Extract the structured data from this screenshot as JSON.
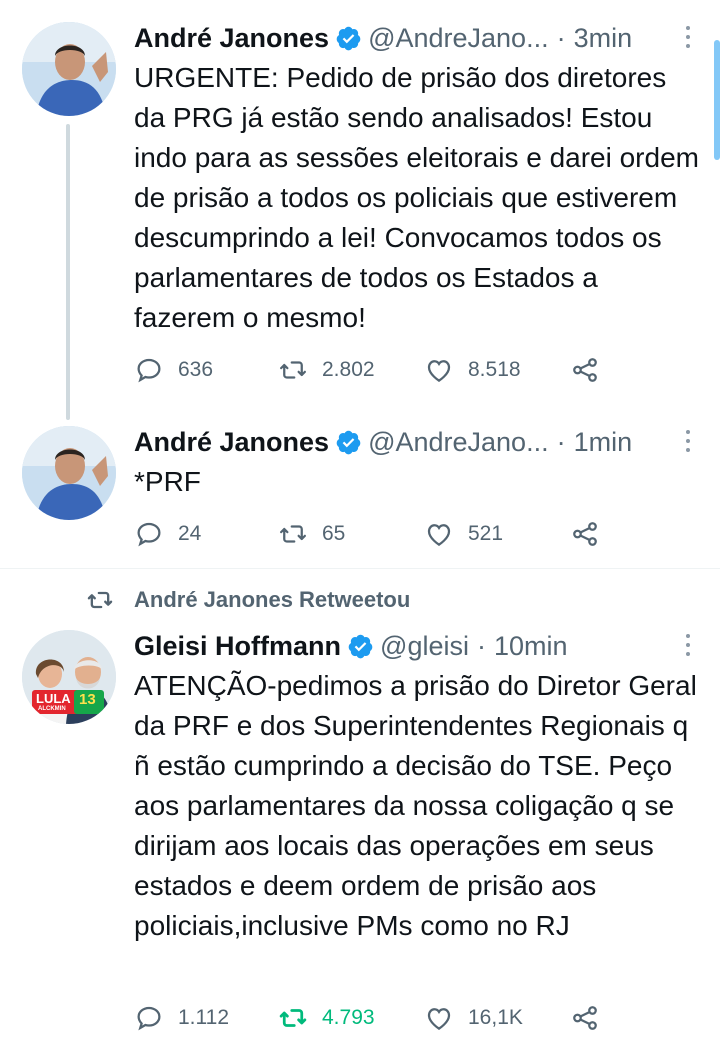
{
  "tweets": [
    {
      "name": "André Janones",
      "handle": "@AndreJano...",
      "dot": "·",
      "time": "3min",
      "text": "URGENTE: Pedido de prisão dos diretores da PRG já estão sendo analisados! Estou indo para as sessões eleitorais e darei ordem de prisão a todos os policiais que estiverem descumprindo a lei! Convocamos todos os parlamentares de todos os Estados a fazerem o mesmo!",
      "replies": "636",
      "retweets": "2.802",
      "likes": "8.518"
    },
    {
      "name": "André Janones",
      "handle": "@AndreJano...",
      "dot": "·",
      "time": "1min",
      "text": "*PRF",
      "replies": "24",
      "retweets": "65",
      "likes": "521"
    },
    {
      "retweeted_by": "André Janones Retweetou",
      "name": "Gleisi Hoffmann",
      "handle": "@gleisi",
      "dot": "·",
      "time": "10min",
      "text": "ATENÇÃO-pedimos a prisão do Diretor Geral da PRF e dos Superintendentes Regionais q ñ estão cumprindo a decisão do TSE. Peço aos parlamentares da nossa coligação q se dirijam aos locais das operações em seus estados e deem ordem de prisão aos policiais,inclusive PMs como no RJ",
      "replies": "1.112",
      "retweets": "4.793",
      "likes": "16,1K"
    }
  ],
  "avatar_badge": {
    "lula": "LULA",
    "number": "13",
    "sub": "ALCKMIN"
  },
  "colors": {
    "verified": "#1d9bf0",
    "retweet_active": "#00ba7c",
    "secondary_text": "#536471"
  },
  "icons": [
    "reply-icon",
    "retweet-icon",
    "like-icon",
    "share-icon",
    "verified-badge-icon",
    "more-options-icon"
  ]
}
